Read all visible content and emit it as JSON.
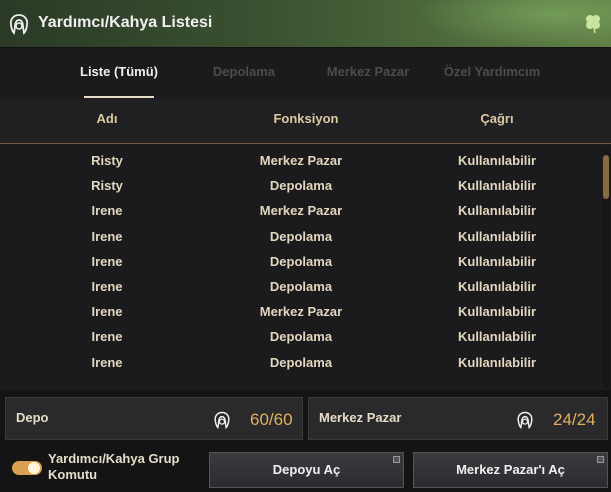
{
  "window": {
    "title": "Yardımcı/Kahya Listesi",
    "title_icon": "maid-head-icon",
    "corner_icon": "clover-icon"
  },
  "tabs": [
    {
      "label": "Liste (Tümü)",
      "active": true
    },
    {
      "label": "Depolama",
      "active": false
    },
    {
      "label": "Merkez Pazar",
      "active": false
    },
    {
      "label": "Özel Yardımcım",
      "active": false
    }
  ],
  "columns": {
    "name": "Adı",
    "function": "Fonksiyon",
    "call": "Çağrı"
  },
  "rows": [
    {
      "name": "Risty",
      "function": "Merkez Pazar",
      "call": "Kullanılabilir"
    },
    {
      "name": "Risty",
      "function": "Depolama",
      "call": "Kullanılabilir"
    },
    {
      "name": "Irene",
      "function": "Merkez Pazar",
      "call": "Kullanılabilir"
    },
    {
      "name": "Irene",
      "function": "Depolama",
      "call": "Kullanılabilir"
    },
    {
      "name": "Irene",
      "function": "Depolama",
      "call": "Kullanılabilir"
    },
    {
      "name": "Irene",
      "function": "Depolama",
      "call": "Kullanılabilir"
    },
    {
      "name": "Irene",
      "function": "Merkez Pazar",
      "call": "Kullanılabilir"
    },
    {
      "name": "Irene",
      "function": "Depolama",
      "call": "Kullanılabilir"
    },
    {
      "name": "Irene",
      "function": "Depolama",
      "call": "Kullanılabilir"
    }
  ],
  "summary": {
    "depo": {
      "label": "Depo",
      "count": "60/60"
    },
    "market": {
      "label": "Merkez Pazar",
      "count": "24/24"
    }
  },
  "footer": {
    "toggle_label": "Yardımcı/Kahya Grup Komutu",
    "toggle_on": true,
    "open_storage": "Depoyu Aç",
    "open_market": "Merkez Pazar'ı Aç"
  },
  "colors": {
    "accent": "#e0b060",
    "header_text": "#ddc9a0",
    "scroll_thumb": "#8a6a3f"
  }
}
